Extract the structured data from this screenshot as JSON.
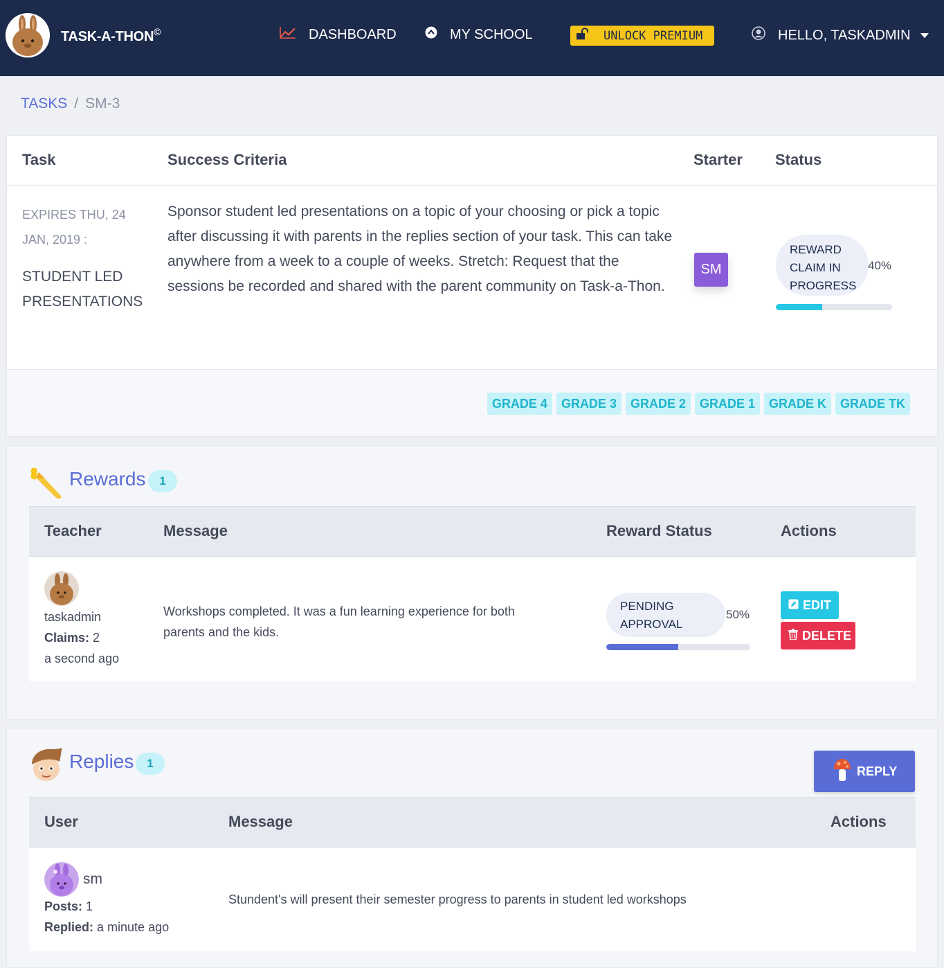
{
  "nav": {
    "brand": "TASK-A-THON",
    "brand_mark": "©",
    "dashboard": "DASHBOARD",
    "my_school": "MY SCHOOL",
    "premium": "UNLOCK PREMIUM",
    "user": "HELLO, TASKADMIN"
  },
  "breadcrumb": {
    "parent": "TASKS",
    "separator": "/",
    "current": "SM-3"
  },
  "task": {
    "headers": {
      "task": "Task",
      "criteria": "Success Criteria",
      "starter": "Starter",
      "status": "Status"
    },
    "expires": "EXPIRES THU, 24 JAN, 2019 :",
    "name": "STUDENT LED PRESENTATIONS",
    "criteria": "Sponsor student led presentations on a topic of your choosing or pick a topic after discussing it with parents in the replies section of your task. This can take anywhere from a week to a couple of weeks. Stretch: Request that the sessions be recorded and shared with the parent community on Task-a-Thon.",
    "starter": "SM",
    "status_label": "REWARD CLAIM IN PROGRESS",
    "status_percent_label": "40%",
    "status_progress": 0.4,
    "grades": [
      "GRADE 4",
      "GRADE 3",
      "GRADE 2",
      "GRADE 1",
      "GRADE K",
      "GRADE TK"
    ]
  },
  "rewards": {
    "title": "Rewards",
    "count": "1",
    "headers": {
      "teacher": "Teacher",
      "message": "Message",
      "status": "Reward Status",
      "actions": "Actions"
    },
    "row": {
      "teacher": "taskadmin",
      "claims_label": "Claims:",
      "claims": "2",
      "time": "a second ago",
      "message": "Workshops completed. It was a fun learning experience for both parents and the kids.",
      "status_label": "PENDING APPROVAL",
      "status_percent_label": "50%",
      "status_progress": 0.5,
      "edit": "EDIT",
      "delete": "DELETE"
    }
  },
  "replies": {
    "title": "Replies",
    "count": "1",
    "reply_button": "REPLY",
    "headers": {
      "user": "User",
      "message": "Message",
      "actions": "Actions"
    },
    "row": {
      "user": "sm",
      "posts_label": "Posts:",
      "posts": "1",
      "replied_label": "Replied:",
      "replied": "a minute ago",
      "message": "Stundent's will present their semester progress to parents in student led workshops"
    }
  },
  "colors": {
    "navbar": "#1c2a4b",
    "accent": "#5a6dd7",
    "premium": "#f5c518",
    "cyan": "#26c6e5",
    "danger": "#e8334f",
    "starter": "#8a5cd9"
  }
}
